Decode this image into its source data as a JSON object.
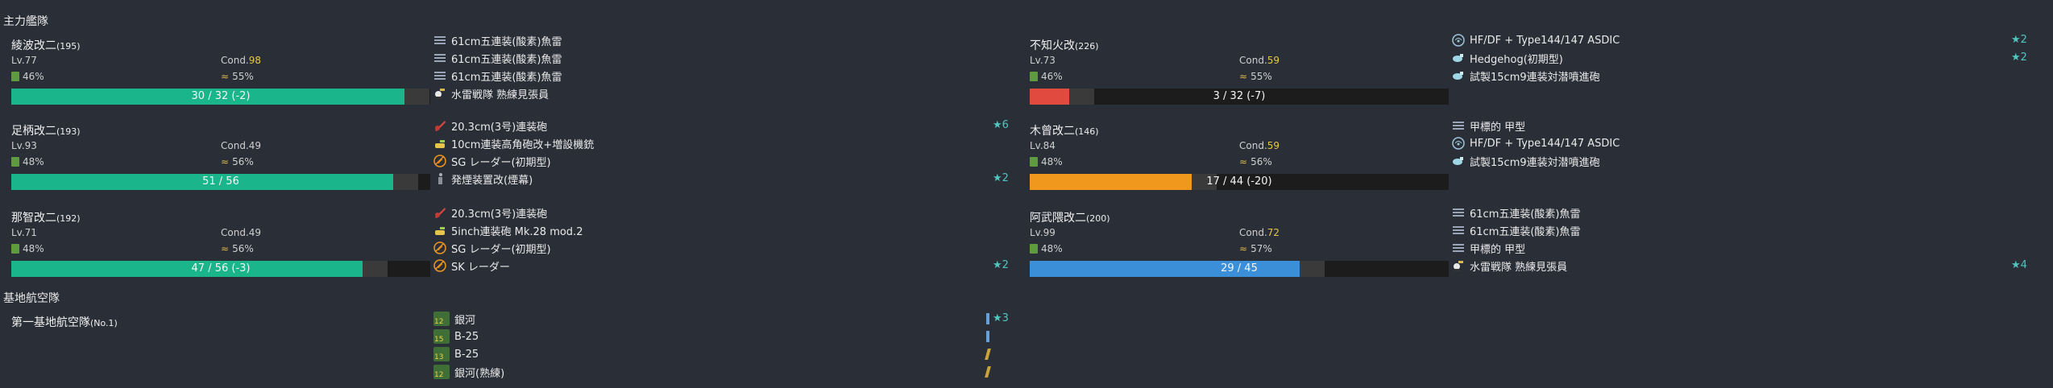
{
  "main_fleet": {
    "title": "主力艦隊",
    "ships": [
      {
        "name": "綾波改二",
        "name_sub": "(195)",
        "level": "Lv.77",
        "cond_label": "Cond.",
        "cond_value": "98",
        "cond_high": true,
        "fuel": "46%",
        "ammo": "55%",
        "hp_text": "30 / 32 (-2)",
        "hp_fraction": 0.9375,
        "hp_color": "#1bb58c",
        "equipment": [
          {
            "icon": "torpedo-icon",
            "name": "61cm五連装(酸素)魚雷",
            "star": ""
          },
          {
            "icon": "torpedo-icon",
            "name": "61cm五連装(酸素)魚雷",
            "star": ""
          },
          {
            "icon": "torpedo-icon",
            "name": "61cm五連装(酸素)魚雷",
            "star": ""
          },
          {
            "icon": "lookout-icon",
            "name": "水雷戦隊 熟練見張員",
            "star": ""
          }
        ]
      },
      {
        "name": "足柄改二",
        "name_sub": "(193)",
        "level": "Lv.93",
        "cond_label": "Cond.",
        "cond_value": "49",
        "cond_high": false,
        "fuel": "48%",
        "ammo": "56%",
        "hp_text": "51 / 56",
        "hp_fraction": 0.9107,
        "hp_color": "#1bb58c",
        "equipment": [
          {
            "icon": "main-gun-icon",
            "name": "20.3cm(3号)連装砲",
            "star": "★6"
          },
          {
            "icon": "secondary-gun-icon",
            "name": "10cm連装高角砲改+増設機銃",
            "star": ""
          },
          {
            "icon": "radar-icon",
            "name": "SG レーダー(初期型)",
            "star": ""
          },
          {
            "icon": "smoke-icon",
            "name": "発煙装置改(煙幕)",
            "star": "★2"
          }
        ]
      },
      {
        "name": "那智改二",
        "name_sub": "(192)",
        "level": "Lv.71",
        "cond_label": "Cond.",
        "cond_value": "49",
        "cond_high": false,
        "fuel": "48%",
        "ammo": "56%",
        "hp_text": "47 / 56 (-3)",
        "hp_fraction": 0.8393,
        "hp_color": "#1bb58c",
        "equipment": [
          {
            "icon": "main-gun-icon",
            "name": "20.3cm(3号)連装砲",
            "star": ""
          },
          {
            "icon": "secondary-gun-icon",
            "name": "5inch連装砲 Mk.28 mod.2",
            "star": ""
          },
          {
            "icon": "radar-icon",
            "name": "SG レーダー(初期型)",
            "star": ""
          },
          {
            "icon": "radar-icon",
            "name": "SK レーダー",
            "star": "★2"
          }
        ]
      },
      {
        "name": "不知火改",
        "name_sub": "(226)",
        "level": "Lv.73",
        "cond_label": "Cond.",
        "cond_value": "59",
        "cond_high": true,
        "fuel": "46%",
        "ammo": "55%",
        "hp_text": "3 / 32 (-7)",
        "hp_fraction": 0.094,
        "hp_color": "#e14b3f",
        "equipment": [
          {
            "icon": "sonar-icon",
            "name": "HF/DF + Type144/147 ASDIC",
            "star": "★2"
          },
          {
            "icon": "depth-charge-icon",
            "name": "Hedgehog(初期型)",
            "star": "★2"
          },
          {
            "icon": "depth-charge-icon",
            "name": "試製15cm9連装対潜噴進砲",
            "star": ""
          }
        ]
      },
      {
        "name": "木曾改二",
        "name_sub": "(146)",
        "level": "Lv.84",
        "cond_label": "Cond.",
        "cond_value": "59",
        "cond_high": true,
        "fuel": "48%",
        "ammo": "56%",
        "hp_text": "17 / 44 (-20)",
        "hp_fraction": 0.3864,
        "hp_color": "#f0971e",
        "equipment": [
          {
            "icon": "midget-sub-icon",
            "name": "甲標的 甲型",
            "star": ""
          },
          {
            "icon": "sonar-icon",
            "name": "HF/DF + Type144/147 ASDIC",
            "star": ""
          },
          {
            "icon": "depth-charge-icon",
            "name": "試製15cm9連装対潜噴進砲",
            "star": ""
          }
        ]
      },
      {
        "name": "阿武隈改二",
        "name_sub": "(200)",
        "level": "Lv.99",
        "cond_label": "Cond.",
        "cond_value": "72",
        "cond_high": true,
        "fuel": "48%",
        "ammo": "57%",
        "hp_text": "29 / 45",
        "hp_fraction": 0.6444,
        "hp_color": "#3a8fd8",
        "equipment": [
          {
            "icon": "torpedo-icon",
            "name": "61cm五連装(酸素)魚雷",
            "star": ""
          },
          {
            "icon": "torpedo-icon",
            "name": "61cm五連装(酸素)魚雷",
            "star": ""
          },
          {
            "icon": "midget-sub-icon",
            "name": "甲標的 甲型",
            "star": ""
          },
          {
            "icon": "lookout-icon",
            "name": "水雷戦隊 熟練見張員",
            "star": "★4"
          }
        ]
      }
    ]
  },
  "base_air": {
    "title": "基地航空隊",
    "squadron_name": "第一基地航空隊",
    "squadron_sub": "(No.1)",
    "planes": [
      {
        "count": "12",
        "name": "銀河",
        "star": "★3",
        "prof_color": "#6a9fd0"
      },
      {
        "count": "15",
        "name": "B-25",
        "star": "",
        "prof_color": "#6a9fd0"
      },
      {
        "count": "13",
        "name": "B-25",
        "star": "",
        "prof_color": "#c9a43a"
      },
      {
        "count": "12",
        "name": "銀河(熟練)",
        "star": "",
        "prof_color": "#c9a43a"
      }
    ]
  },
  "colors": {
    "background": "#2a2e37",
    "hp_green": "#1bb58c",
    "hp_red": "#e14b3f",
    "hp_orange": "#f0971e",
    "hp_blue": "#3a8fd8",
    "star": "#4ec7c0",
    "cond_high": "#e6c64a"
  }
}
